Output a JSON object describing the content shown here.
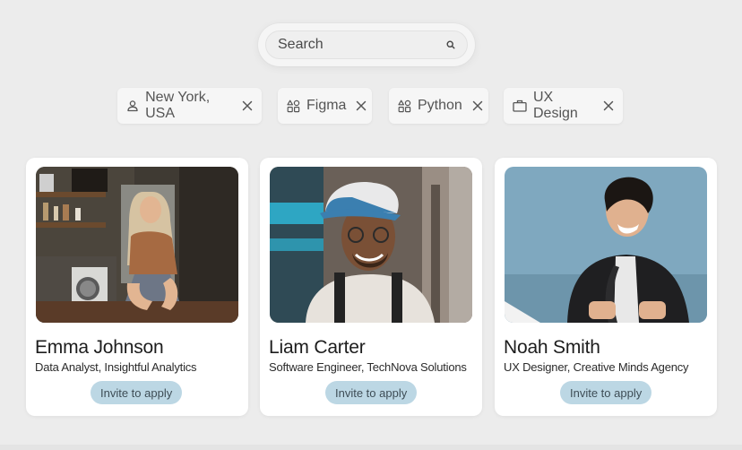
{
  "search": {
    "placeholder": "Search",
    "icon": "search-icon"
  },
  "filters": [
    {
      "label": "New York, USA",
      "icon": "person-icon"
    },
    {
      "label": "Figma",
      "icon": "shapes-icon"
    },
    {
      "label": "Python",
      "icon": "shapes-icon"
    },
    {
      "label": "UX Design",
      "icon": "briefcase-icon"
    }
  ],
  "candidates": [
    {
      "name": "Emma Johnson",
      "role": "Data Analyst, Insightful Analytics",
      "action": "Invite to apply"
    },
    {
      "name": "Liam Carter",
      "role": "Software Engineer, TechNova Solutions",
      "action": "Invite to apply"
    },
    {
      "name": "Noah Smith",
      "role": "UX Designer, Creative Minds Agency",
      "action": "Invite to apply"
    }
  ],
  "colors": {
    "background": "#ececec",
    "card": "#ffffff",
    "button": "#bcd7e4"
  }
}
